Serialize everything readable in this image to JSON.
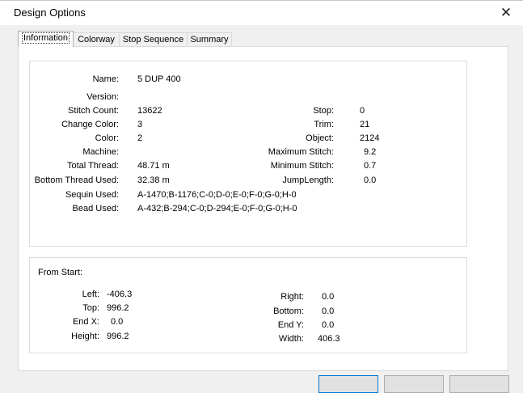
{
  "window": {
    "title": "Design Options"
  },
  "tabs": [
    {
      "label": "Information"
    },
    {
      "label": "Colorway"
    },
    {
      "label": "Stop Sequence"
    },
    {
      "label": "Summary"
    }
  ],
  "info": {
    "name_label": "Name:",
    "name_value": "5 DUP 400",
    "version_label": "Version:",
    "version_value": "",
    "stitch_count_label": "Stitch Count:",
    "stitch_count_value": "13622",
    "change_color_label": "Change Color:",
    "change_color_value": "3",
    "color_label": "Color:",
    "color_value": "2",
    "machine_label": "Machine:",
    "machine_value": "",
    "total_thread_label": "Total Thread:",
    "total_thread_value": "48.71 m",
    "bottom_thread_label": "Bottom Thread Used:",
    "bottom_thread_value": "32.38 m",
    "sequin_label": "Sequin Used:",
    "sequin_value": "A-1470;B-1176;C-0;D-0;E-0;F-0;G-0;H-0",
    "bead_label": "Bead Used:",
    "bead_value": "A-432;B-294;C-0;D-294;E-0;F-0;G-0;H-0",
    "stop_label": "Stop:",
    "stop_value": "0",
    "trim_label": "Trim:",
    "trim_value": "21",
    "object_label": "Object:",
    "object_value": "2124",
    "max_stitch_label": "Maximum Stitch:",
    "max_stitch_value": "9.2",
    "min_stitch_label": "Minimum Stitch:",
    "min_stitch_value": "0.7",
    "jump_length_label": "JumpLength:",
    "jump_length_value": "0.0"
  },
  "from_start": {
    "heading": "From Start:",
    "left_label": "Left:",
    "left_value": "-406.3",
    "top_label": "Top:",
    "top_value": "996.2",
    "endx_label": "End X:",
    "endx_value": "0.0",
    "height_label": "Height:",
    "height_value": "996.2",
    "right_label": "Right:",
    "right_value": "0.0",
    "bottom_label": "Bottom:",
    "bottom_value": "0.0",
    "endy_label": "End Y:",
    "endy_value": "0.0",
    "width_label": "Width:",
    "width_value": "406.3"
  }
}
